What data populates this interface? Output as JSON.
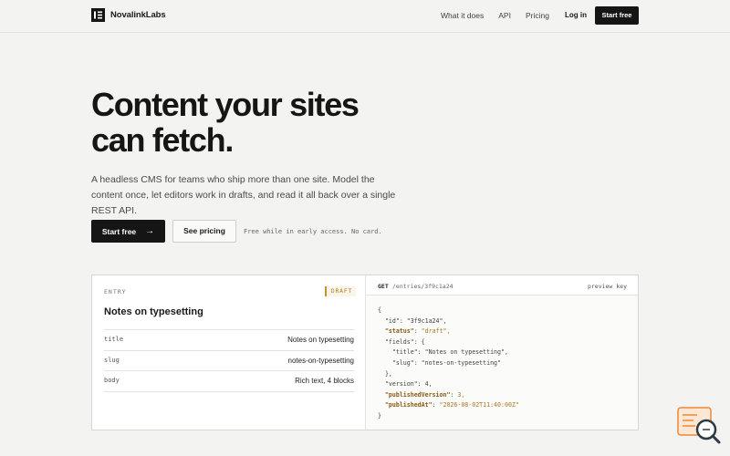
{
  "nav": {
    "brand": "NovalinkLabs",
    "links": [
      "What it does",
      "API",
      "Pricing"
    ],
    "login": "Log in",
    "cta": "Start free"
  },
  "hero": {
    "title_line1": "Content your sites",
    "title_line2": "can fetch.",
    "subtitle": "A headless CMS for teams who ship more than one site. Model the content once, let editors work in drafts, and read it all back over a single REST API.",
    "primary_button": "Start free",
    "secondary_button": "See pricing",
    "note": "Free while in early access. No card."
  },
  "entry_card": {
    "label": "ENTRY",
    "badge": "DRAFT",
    "title": "Notes on typesetting",
    "fields": [
      {
        "key": "title",
        "value": "Notes on typesetting"
      },
      {
        "key": "slug",
        "value": "notes-on-typesetting"
      },
      {
        "key": "body",
        "value": "Rich text, 4 blocks"
      }
    ]
  },
  "api_panel": {
    "method": "GET",
    "path": "/entries/3f9c1a24",
    "key_label": "preview key",
    "json_lines": [
      {
        "indent": 0,
        "text": "{",
        "hl": false
      },
      {
        "indent": 1,
        "text": "\"id\": \"3f9c1a24\",",
        "hl": false
      },
      {
        "indent": 1,
        "text": "\"status\": \"draft\",",
        "hl": true
      },
      {
        "indent": 1,
        "text": "\"fields\": {",
        "hl": false
      },
      {
        "indent": 2,
        "text": "\"title\": \"Notes on typesetting\",",
        "hl": false
      },
      {
        "indent": 2,
        "text": "\"slug\": \"notes-on-typesetting\"",
        "hl": false
      },
      {
        "indent": 1,
        "text": "},",
        "hl": false
      },
      {
        "indent": 1,
        "text": "\"version\": 4,",
        "hl": false
      },
      {
        "indent": 1,
        "text": "\"publishedVersion\": 3,",
        "hl": true
      },
      {
        "indent": 1,
        "text": "\"publishedAt\": \"2026-08-02T11:40:00Z\"",
        "hl": true
      },
      {
        "indent": 0,
        "text": "}",
        "hl": false
      }
    ]
  },
  "colors": {
    "background": "#f3f3f1",
    "ink": "#151515",
    "accent": "#c8912f"
  }
}
